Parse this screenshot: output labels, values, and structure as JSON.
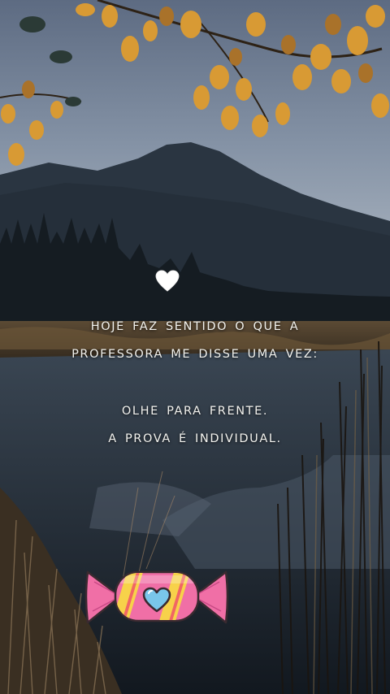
{
  "quote": {
    "line1": "HOJE FAZ SENTIDO O QUE A",
    "line2": "PROFESSORA ME DISSE UMA VEZ:",
    "line3": "OLHE PARA FRENTE.",
    "line4": "A PROVA É INDIVIDUAL."
  },
  "stickers": {
    "heart": "white-heart-icon",
    "candy": "candy-heart-icon"
  },
  "colors": {
    "sky": "#6f7f95",
    "mountain": "#2c3743",
    "leaves": "#d79a35",
    "water": "#1b2430",
    "candy_pink": "#f06fa6",
    "candy_yellow": "#f7d24a",
    "candy_heart": "#79c6ea"
  }
}
